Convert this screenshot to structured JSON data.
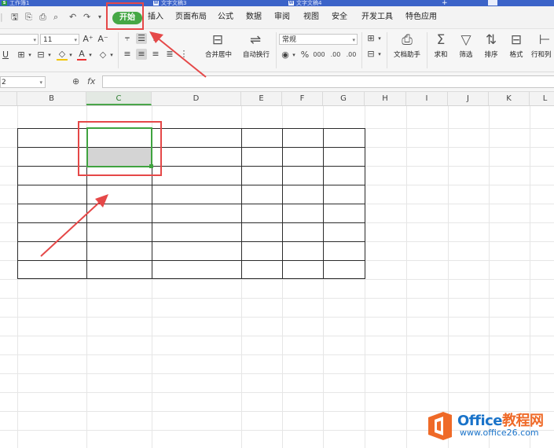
{
  "title_bar": {
    "tabs": [
      "工作簿1",
      "文字文稿3",
      "文字文稿4"
    ]
  },
  "quick_access": [
    "save-icon",
    "format-painter-icon",
    "print-icon",
    "print-preview-icon",
    "undo-icon",
    "redo-icon",
    "more-icon"
  ],
  "menu": {
    "items": [
      "开始",
      "插入",
      "页面布局",
      "公式",
      "数据",
      "审阅",
      "视图",
      "安全",
      "开发工具",
      "特色应用"
    ],
    "active": "开始"
  },
  "ribbon": {
    "font_size": "11",
    "font_grow": "A⁺",
    "font_shrink": "A⁻",
    "merge_center": "合并居中",
    "auto_wrap": "自动换行",
    "number_format": "常规",
    "percent": "%",
    "comma": "000",
    "inc_decimal": ".00",
    "dec_decimal": ".00",
    "doc_assistant": "文档助手",
    "sum": "求和",
    "filter": "筛选",
    "sort": "排序",
    "format": "格式",
    "rows_cols": "行和列"
  },
  "formula_bar": {
    "name_box": "2",
    "fx": "fx"
  },
  "columns": [
    "B",
    "C",
    "D",
    "E",
    "F",
    "G",
    "H",
    "I",
    "J",
    "K",
    "L"
  ],
  "selected_column": "C",
  "annotations": {
    "highlight_color": "#e54848",
    "start_color": "#45a745"
  }
}
